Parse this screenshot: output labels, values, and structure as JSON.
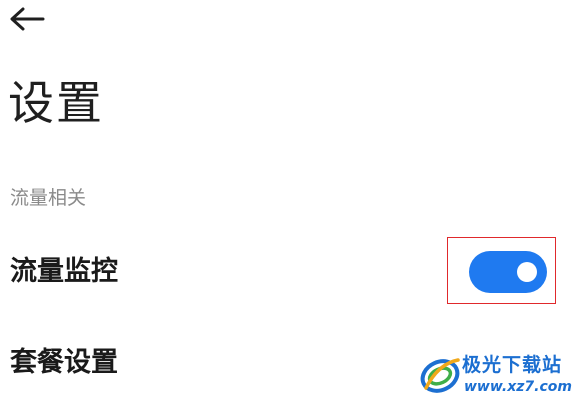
{
  "header": {
    "back_icon": "arrow-left-icon"
  },
  "page": {
    "title": "设置"
  },
  "section": {
    "header": "流量相关"
  },
  "rows": [
    {
      "label": "流量监控",
      "control": "toggle",
      "enabled": true
    },
    {
      "label": "套餐设置"
    }
  ],
  "colors": {
    "toggle_on": "#1f7af0",
    "highlight_border": "#e0292c",
    "section_header": "#8a8a8a",
    "watermark": "#1c6fd1"
  },
  "watermark": {
    "name": "极光下载站",
    "url": "www.xz7.com"
  }
}
